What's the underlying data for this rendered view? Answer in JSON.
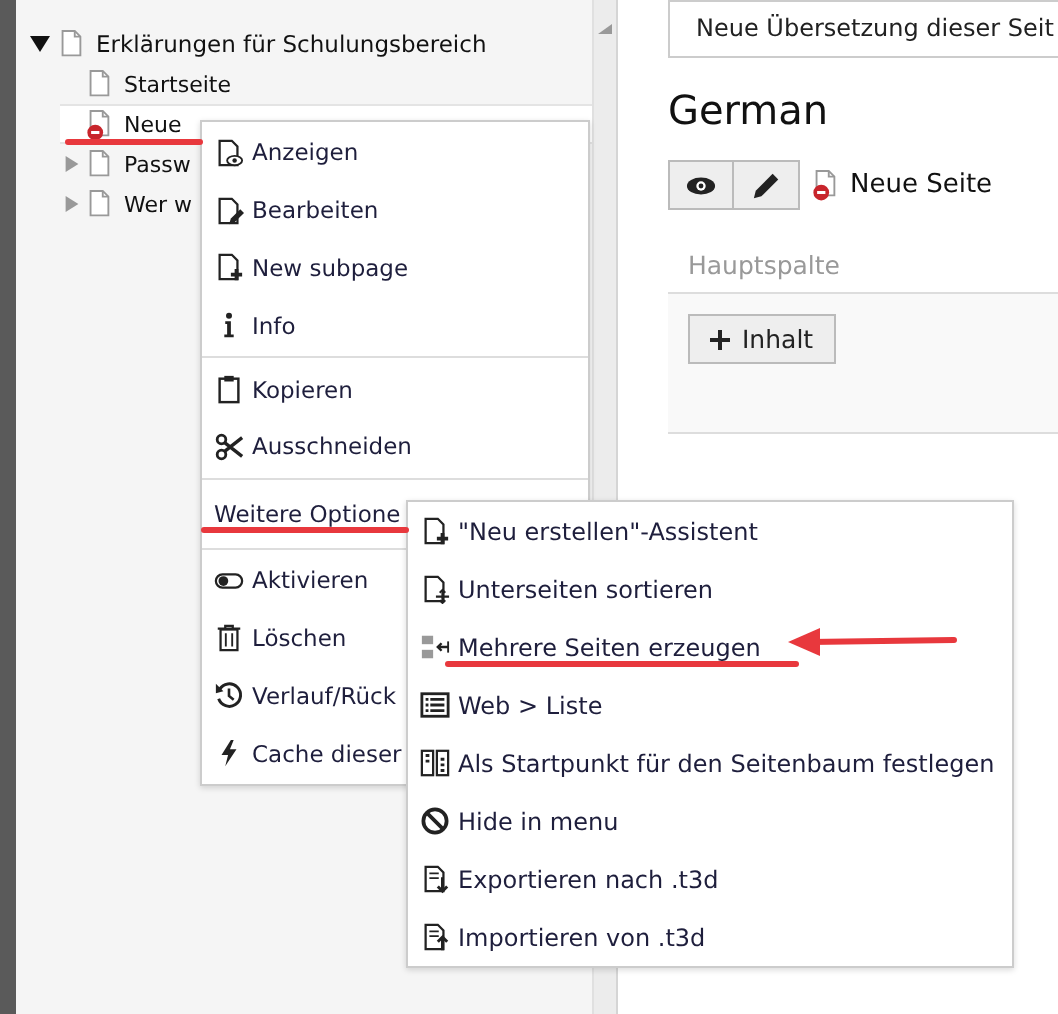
{
  "tree": {
    "items": [
      {
        "label": "Erklärungen für Schulungsbereich",
        "expanded": true,
        "hidden": false,
        "selected": false,
        "children": [
          {
            "label": "Startseite",
            "hidden": false,
            "selected": false
          },
          {
            "label": "Neue",
            "hidden": true,
            "selected": true
          },
          {
            "label": "Passw",
            "expanded": false,
            "hidden": false,
            "selected": false
          },
          {
            "label": "Wer w",
            "expanded": false,
            "hidden": false,
            "selected": false
          }
        ]
      }
    ]
  },
  "context_menu": {
    "groups": [
      {
        "items": [
          {
            "label": "Anzeigen",
            "kind": "action"
          },
          {
            "label": "Bearbeiten",
            "kind": "action"
          },
          {
            "label": "New subpage",
            "kind": "action"
          },
          {
            "label": "Info",
            "kind": "action"
          }
        ]
      },
      {
        "items": [
          {
            "label": "Kopieren",
            "kind": "action"
          },
          {
            "label": "Ausschneiden",
            "kind": "action"
          }
        ]
      },
      {
        "items": [
          {
            "label": "Weitere Optione",
            "kind": "submenu"
          }
        ]
      },
      {
        "items": [
          {
            "label": "Aktivieren",
            "kind": "action"
          },
          {
            "label": "Löschen",
            "kind": "action"
          },
          {
            "label": "Verlauf/Rück",
            "kind": "action"
          },
          {
            "label": "Cache dieser",
            "kind": "action"
          }
        ]
      }
    ]
  },
  "submenu": {
    "items": [
      {
        "label": "\"Neu erstellen\"-Assistent"
      },
      {
        "label": "Unterseiten sortieren"
      },
      {
        "label": "Mehrere Seiten erzeugen"
      },
      {
        "label": "Web > Liste"
      },
      {
        "label": "Als Startpunkt für den Seitenbaum festlegen"
      },
      {
        "label": "Hide in menu"
      },
      {
        "label": "Exportieren nach .t3d"
      },
      {
        "label": "Importieren von .t3d"
      }
    ]
  },
  "content": {
    "language_select": {
      "value": "Neue Übersetzung dieser Seit"
    },
    "heading": "German",
    "page": {
      "title": "Neue Seite",
      "hidden": true
    },
    "column": {
      "title": "Hauptspalte",
      "add_button": "Inhalt"
    }
  }
}
